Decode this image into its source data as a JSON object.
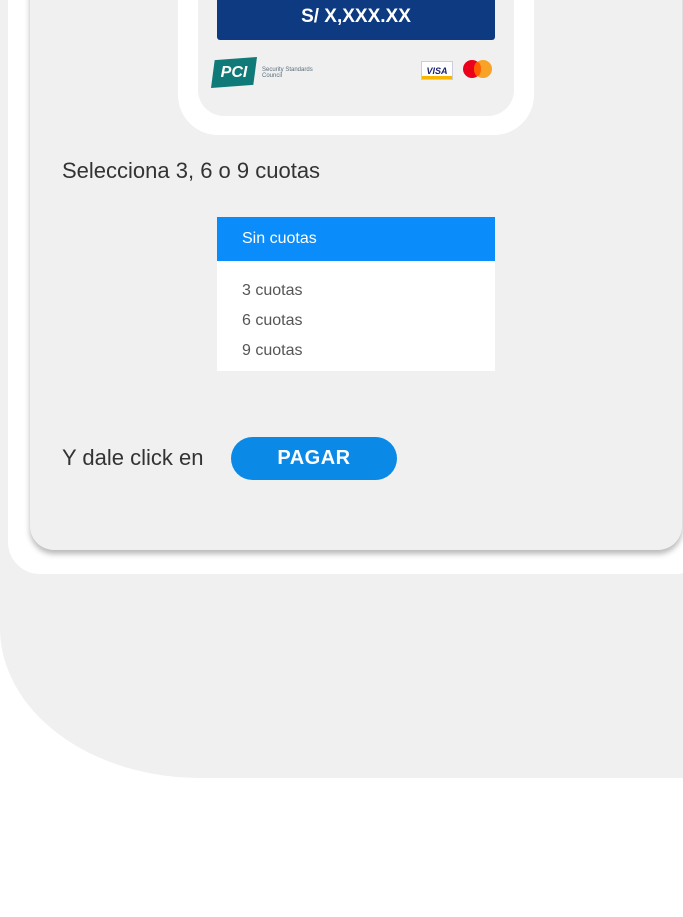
{
  "amount": "S/ X,XXX.XX",
  "logos": {
    "pci": {
      "mark": "PCI",
      "text": "Security Standards Council"
    },
    "visa": "VISA"
  },
  "instruction_select": "Selecciona 3, 6 o 9 cuotas",
  "dropdown": {
    "selected": "Sin cuotas",
    "options": [
      "3 cuotas",
      "6 cuotas",
      "9 cuotas"
    ]
  },
  "instruction_pay": "Y dale click en",
  "pay_button": "PAGAR",
  "colors": {
    "amount_bar": "#0d3a80",
    "dropdown_selected": "#0a8cfb",
    "pay_button": "#0a8ae6",
    "background": "#f0f0f0"
  }
}
